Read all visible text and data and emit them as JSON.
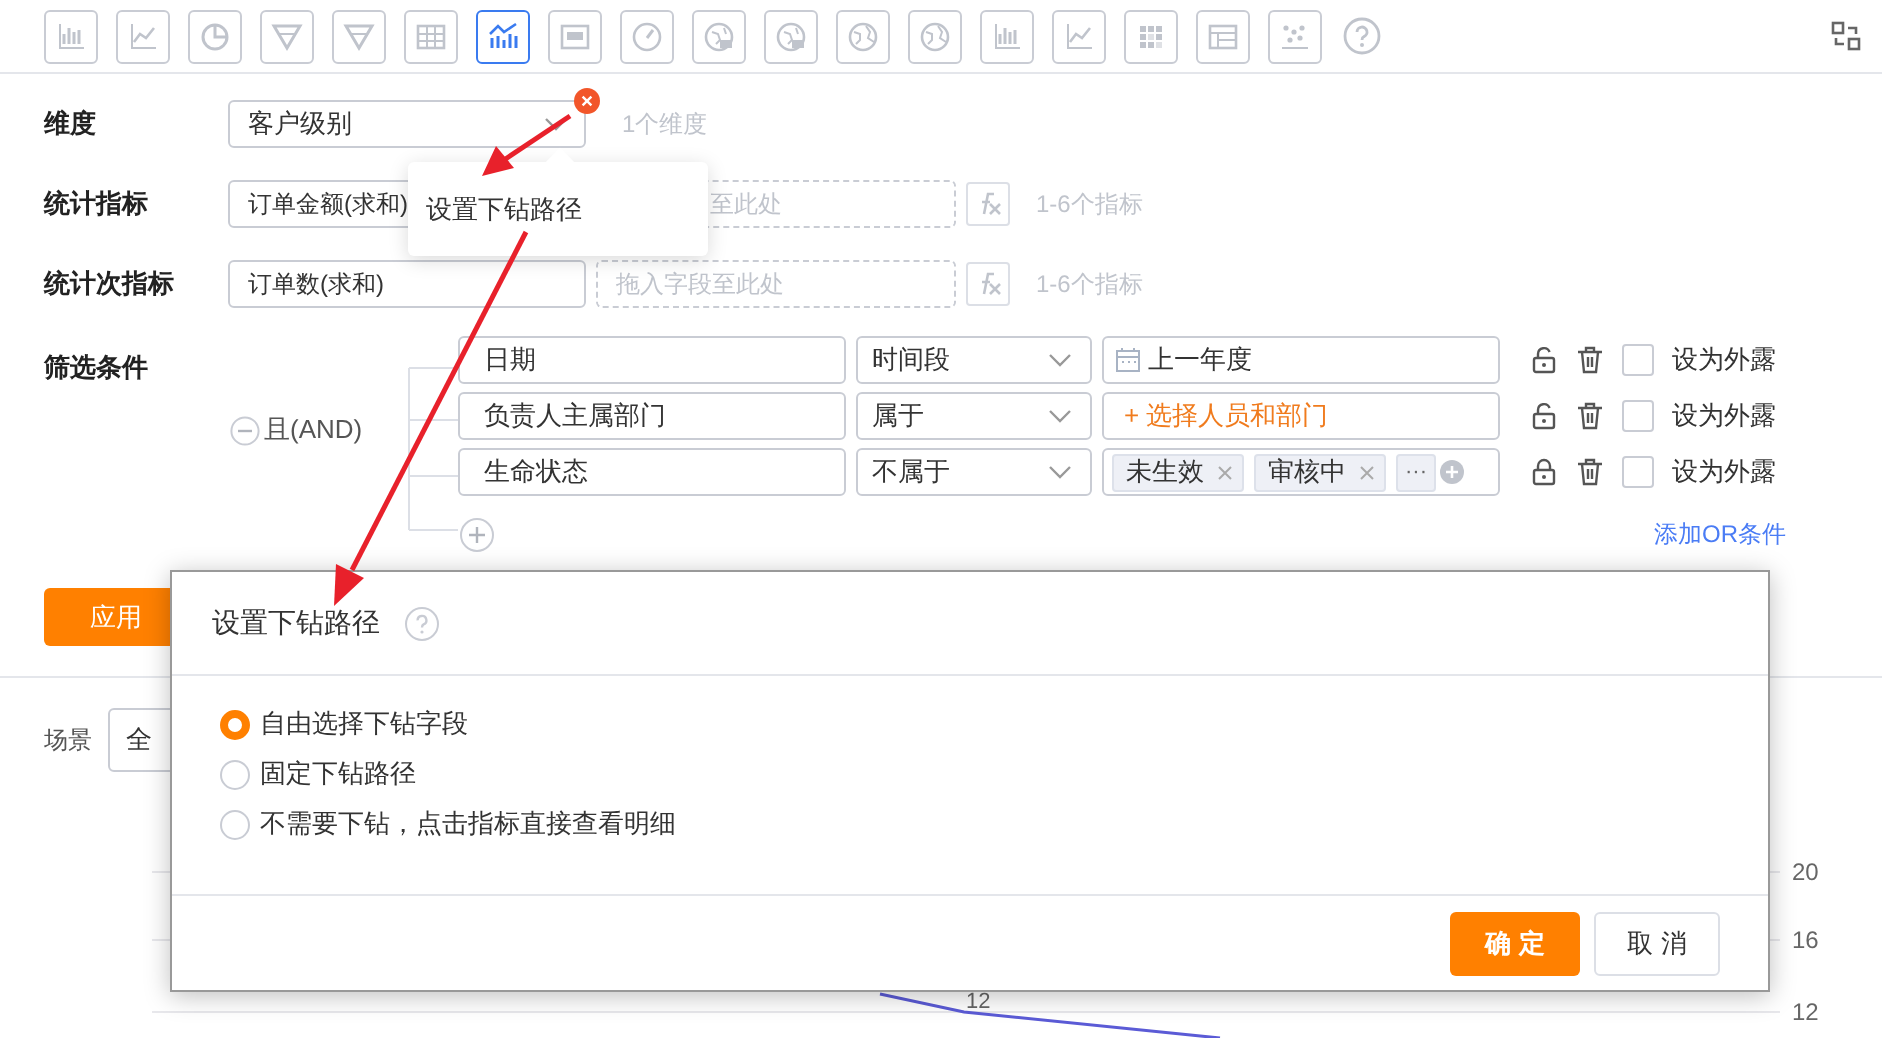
{
  "chart_types": [
    {
      "kind": "bar",
      "selected": false
    },
    {
      "kind": "line",
      "selected": false
    },
    {
      "kind": "pie",
      "selected": false
    },
    {
      "kind": "funnel",
      "selected": false
    },
    {
      "kind": "funnel",
      "selected": false
    },
    {
      "kind": "table",
      "selected": false
    },
    {
      "kind": "combo",
      "selected": true
    },
    {
      "kind": "card",
      "selected": false
    },
    {
      "kind": "gauge",
      "selected": false
    },
    {
      "kind": "map",
      "selected": false
    },
    {
      "kind": "map",
      "selected": false
    },
    {
      "kind": "globe",
      "selected": false
    },
    {
      "kind": "globe",
      "selected": false
    },
    {
      "kind": "bar",
      "selected": false
    },
    {
      "kind": "line",
      "selected": false
    },
    {
      "kind": "grid",
      "selected": false
    },
    {
      "kind": "layout",
      "selected": false
    },
    {
      "kind": "scatter",
      "selected": false
    }
  ],
  "dimension": {
    "label": "维度",
    "value": "客户级别",
    "hint": "1个维度"
  },
  "metric": {
    "label": "统计指标",
    "value": "订单金额(求和)",
    "drop_placeholder": "至此处",
    "hint": "1-6个指标"
  },
  "sub_metric": {
    "label": "统计次指标",
    "value": "订单数(求和)",
    "drop_placeholder": "拖入字段至此处",
    "hint": "1-6个指标"
  },
  "filter": {
    "label": "筛选条件",
    "logic": "且(AND)",
    "add_or": "添加OR条件",
    "conditions": [
      {
        "field": "日期",
        "operator": "时间段",
        "value": {
          "kind": "date",
          "text": "上一年度"
        },
        "locked": false,
        "exposed": false,
        "expose_label": "设为外露"
      },
      {
        "field": "负责人主属部门",
        "operator": "属于",
        "value": {
          "kind": "picker",
          "text": "+ 选择人员和部门"
        },
        "locked": false,
        "exposed": false,
        "expose_label": "设为外露"
      },
      {
        "field": "生命状态",
        "operator": "不属于",
        "value": {
          "kind": "tags",
          "tags": [
            "未生效",
            "审核中"
          ],
          "more": "···"
        },
        "locked": true,
        "exposed": false,
        "expose_label": "设为外露"
      }
    ]
  },
  "apply_button": "应用",
  "scene": {
    "label": "场景",
    "value": "全"
  },
  "chart": {
    "axis_labels": [
      "20",
      "16",
      "12"
    ],
    "point_label": "12"
  },
  "popover": {
    "text": "设置下钻路径"
  },
  "dialog": {
    "title": "设置下钻路径",
    "options": [
      {
        "label": "自由选择下钻字段",
        "selected": true
      },
      {
        "label": "固定下钻路径",
        "selected": false
      },
      {
        "label": "不需要下钻，点击指标直接查看明细",
        "selected": false
      }
    ],
    "buttons": [
      {
        "label": "确 定",
        "kind": "primary"
      },
      {
        "label": "取 消",
        "kind": "default"
      }
    ]
  }
}
